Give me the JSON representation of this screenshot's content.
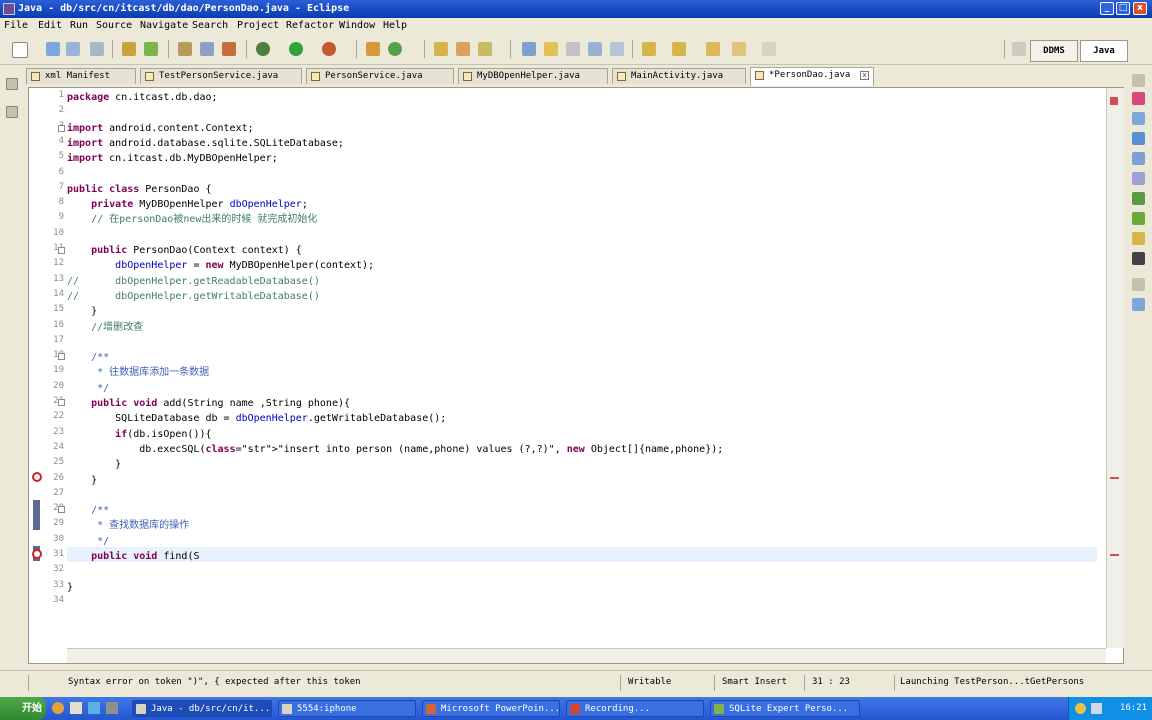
{
  "window": {
    "title": "Java - db/src/cn/itcast/db/dao/PersonDao.java - Eclipse",
    "min": "_",
    "max": "□",
    "close": "x"
  },
  "menu": [
    "File",
    "Edit",
    "Run",
    "Source",
    "Navigate",
    "Search",
    "Project",
    "Refactor",
    "Window",
    "Help"
  ],
  "perspectives": [
    "DDMS",
    "Java"
  ],
  "tabs": [
    {
      "label": "xml Manifest",
      "active": false
    },
    {
      "label": "TestPersonService.java",
      "active": false
    },
    {
      "label": "PersonService.java",
      "active": false
    },
    {
      "label": "MyDBOpenHelper.java",
      "active": false
    },
    {
      "label": "MainActivity.java",
      "active": false
    },
    {
      "label": "*PersonDao.java",
      "active": true,
      "close": "x"
    }
  ],
  "code": {
    "line_numbers": [
      "1",
      "2",
      "3",
      "4",
      "5",
      "6",
      "7",
      "8",
      "9",
      "10",
      "11",
      "12",
      "13",
      "14",
      "15",
      "16",
      "17",
      "18",
      "19",
      "20",
      "21",
      "22",
      "23",
      "24",
      "25",
      "26",
      "27",
      "28",
      "29",
      "30",
      "31",
      "32",
      "33",
      "34"
    ],
    "lines": [
      "package cn.itcast.db.dao;",
      "",
      "import android.content.Context;",
      "import android.database.sqlite.SQLiteDatabase;",
      "import cn.itcast.db.MyDBOpenHelper;",
      "",
      "public class PersonDao {",
      "    private MyDBOpenHelper dbOpenHelper;",
      "    // 在personDao被new出来的时候 就完成初始化",
      "",
      "    public PersonDao(Context context) {",
      "        dbOpenHelper = new MyDBOpenHelper(context);",
      "//      dbOpenHelper.getReadableDatabase()",
      "//      dbOpenHelper.getWritableDatabase()",
      "    }",
      "    //增删改查",
      "",
      "    /**",
      "     * 往数据库添加一条数据",
      "     */",
      "    public void add(String name ,String phone){",
      "        SQLiteDatabase db = dbOpenHelper.getWritableDatabase();",
      "        if(db.isOpen()){",
      "            db.execSQL(\"insert into person (name,phone) values (?,?)\", new Object[]{name,phone});",
      "        }",
      "    }",
      "",
      "    /**",
      "     * 查找数据库的操作",
      "     */",
      "    public void find(S",
      "",
      "}",
      ""
    ]
  },
  "status": {
    "message": "Syntax error on token \")\", { expected after this token",
    "mode": "Writable",
    "insert": "Smart Insert",
    "position": "31 : 23",
    "launch": "Launching TestPerson...tGetPersons"
  },
  "taskbar": {
    "start": "开始",
    "items": [
      "Java - db/src/cn/it...",
      "5554:iphone",
      "Microsoft PowerPoin...",
      "Recording...",
      "SQLite Expert Perso..."
    ],
    "clock": "16:21"
  }
}
